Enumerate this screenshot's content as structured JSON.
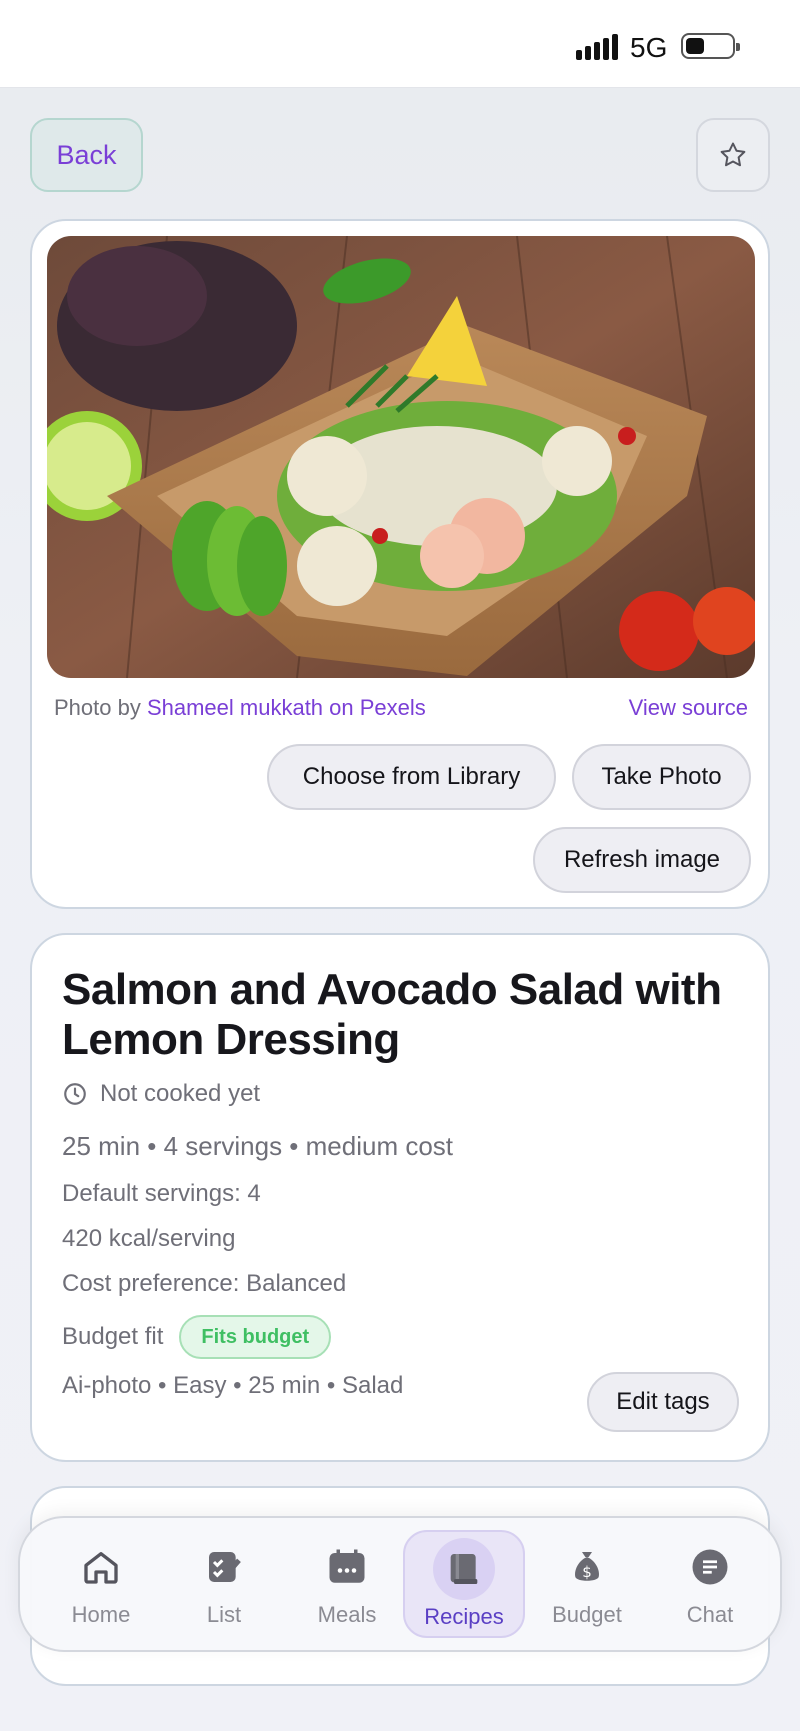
{
  "status_bar": {
    "network": "5G"
  },
  "header": {
    "back_label": "Back",
    "favorite_icon": "star-icon"
  },
  "photo": {
    "credit_prefix": "Photo by ",
    "photographer": "Shameel mukkath",
    "credit_suffix": " on Pexels",
    "view_source": "View source",
    "choose_library": "Choose from Library",
    "take_photo": "Take Photo",
    "refresh_image": "Refresh image"
  },
  "recipe": {
    "title": "Salmon and Avocado Salad with Lemon Dressing",
    "cook_status": "Not cooked yet",
    "meta": "25 min • 4 servings • medium cost",
    "default_servings": "Default servings: 4",
    "kcal": "420 kcal/serving",
    "cost_preference": "Cost preference: Balanced",
    "budget_fit_label": "Budget fit",
    "budget_badge": "Fits budget",
    "tags": "Ai-photo • Easy • 25 min • Salad",
    "edit_tags": "Edit tags"
  },
  "colors": {
    "accent": "#7a3fd6",
    "success": "#3fbf63",
    "tab_active": "#5a3fc4"
  },
  "tabbar": {
    "home": "Home",
    "list": "List",
    "meals": "Meals",
    "recipes": "Recipes",
    "budget": "Budget",
    "chat": "Chat",
    "active": "Recipes"
  }
}
